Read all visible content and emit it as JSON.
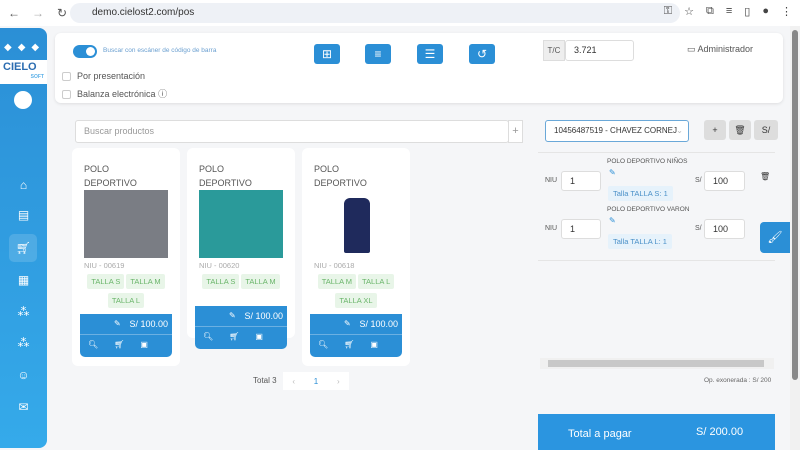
{
  "browser": {
    "url": "demo.cielost2.com/pos"
  },
  "brand": {
    "name": "CIELO",
    "sub": "SOFT"
  },
  "top": {
    "scanner_label": "Buscar con escáner de código de barra",
    "by_presentation": "Por presentación",
    "scale": "Balanza electrónica",
    "tc_label": "T/C",
    "tc_value": "3.721",
    "user": "Administrador"
  },
  "search": {
    "placeholder": "Buscar productos"
  },
  "products": [
    {
      "name": "POLO DEPORTIVO MUJER",
      "code": "NIU - 00619",
      "sizes": [
        "TALLA S",
        "TALLA M",
        "TALLA L"
      ],
      "price": "S/ 100.00",
      "image_color": "#7a7d84"
    },
    {
      "name": "POLO DEPORTIVO NIÑOS",
      "code": "NIU - 00620",
      "sizes": [
        "TALLA S",
        "TALLA M"
      ],
      "price": "S/ 100.00",
      "image_color": "#2a9a9a"
    },
    {
      "name": "POLO DEPORTIVO VARON",
      "code": "NIU - 00618",
      "sizes": [
        "TALLA M",
        "TALLA L",
        "TALLA XL"
      ],
      "price": "S/ 100.00",
      "image_color": "#1f2a5c"
    }
  ],
  "pagination": {
    "total": "Total 3",
    "page": "1"
  },
  "cart": {
    "customer": "10456487519 - CHAVEZ CORNEJ",
    "currency_btn": "S/",
    "items": [
      {
        "unit": "NIU",
        "qty": "1",
        "name": "POLO DEPORTIVO NIÑOS",
        "variant": "Talla TALLA S: 1",
        "cur": "S/",
        "price": "100"
      },
      {
        "unit": "NIU",
        "qty": "1",
        "name": "POLO DEPORTIVO VARON",
        "variant": "Talla TALLA L: 1",
        "cur": "S/",
        "price": "100"
      }
    ],
    "exonerated": "Op. exonerada : S/ 200",
    "total_label": "Total a pagar",
    "total_value": "S/ 200.00"
  }
}
